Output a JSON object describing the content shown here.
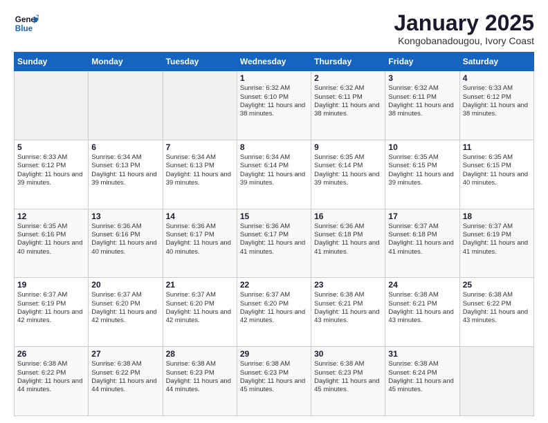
{
  "logo": {
    "line1": "General",
    "line2": "Blue"
  },
  "title": "January 2025",
  "subtitle": "Kongobanadougou, Ivory Coast",
  "days_header": [
    "Sunday",
    "Monday",
    "Tuesday",
    "Wednesday",
    "Thursday",
    "Friday",
    "Saturday"
  ],
  "weeks": [
    [
      {
        "day": "",
        "info": ""
      },
      {
        "day": "",
        "info": ""
      },
      {
        "day": "",
        "info": ""
      },
      {
        "day": "1",
        "info": "Sunrise: 6:32 AM\nSunset: 6:10 PM\nDaylight: 11 hours and 38 minutes."
      },
      {
        "day": "2",
        "info": "Sunrise: 6:32 AM\nSunset: 6:11 PM\nDaylight: 11 hours and 38 minutes."
      },
      {
        "day": "3",
        "info": "Sunrise: 6:32 AM\nSunset: 6:11 PM\nDaylight: 11 hours and 38 minutes."
      },
      {
        "day": "4",
        "info": "Sunrise: 6:33 AM\nSunset: 6:12 PM\nDaylight: 11 hours and 38 minutes."
      }
    ],
    [
      {
        "day": "5",
        "info": "Sunrise: 6:33 AM\nSunset: 6:12 PM\nDaylight: 11 hours and 39 minutes."
      },
      {
        "day": "6",
        "info": "Sunrise: 6:34 AM\nSunset: 6:13 PM\nDaylight: 11 hours and 39 minutes."
      },
      {
        "day": "7",
        "info": "Sunrise: 6:34 AM\nSunset: 6:13 PM\nDaylight: 11 hours and 39 minutes."
      },
      {
        "day": "8",
        "info": "Sunrise: 6:34 AM\nSunset: 6:14 PM\nDaylight: 11 hours and 39 minutes."
      },
      {
        "day": "9",
        "info": "Sunrise: 6:35 AM\nSunset: 6:14 PM\nDaylight: 11 hours and 39 minutes."
      },
      {
        "day": "10",
        "info": "Sunrise: 6:35 AM\nSunset: 6:15 PM\nDaylight: 11 hours and 39 minutes."
      },
      {
        "day": "11",
        "info": "Sunrise: 6:35 AM\nSunset: 6:15 PM\nDaylight: 11 hours and 40 minutes."
      }
    ],
    [
      {
        "day": "12",
        "info": "Sunrise: 6:35 AM\nSunset: 6:16 PM\nDaylight: 11 hours and 40 minutes."
      },
      {
        "day": "13",
        "info": "Sunrise: 6:36 AM\nSunset: 6:16 PM\nDaylight: 11 hours and 40 minutes."
      },
      {
        "day": "14",
        "info": "Sunrise: 6:36 AM\nSunset: 6:17 PM\nDaylight: 11 hours and 40 minutes."
      },
      {
        "day": "15",
        "info": "Sunrise: 6:36 AM\nSunset: 6:17 PM\nDaylight: 11 hours and 41 minutes."
      },
      {
        "day": "16",
        "info": "Sunrise: 6:36 AM\nSunset: 6:18 PM\nDaylight: 11 hours and 41 minutes."
      },
      {
        "day": "17",
        "info": "Sunrise: 6:37 AM\nSunset: 6:18 PM\nDaylight: 11 hours and 41 minutes."
      },
      {
        "day": "18",
        "info": "Sunrise: 6:37 AM\nSunset: 6:19 PM\nDaylight: 11 hours and 41 minutes."
      }
    ],
    [
      {
        "day": "19",
        "info": "Sunrise: 6:37 AM\nSunset: 6:19 PM\nDaylight: 11 hours and 42 minutes."
      },
      {
        "day": "20",
        "info": "Sunrise: 6:37 AM\nSunset: 6:20 PM\nDaylight: 11 hours and 42 minutes."
      },
      {
        "day": "21",
        "info": "Sunrise: 6:37 AM\nSunset: 6:20 PM\nDaylight: 11 hours and 42 minutes."
      },
      {
        "day": "22",
        "info": "Sunrise: 6:37 AM\nSunset: 6:20 PM\nDaylight: 11 hours and 42 minutes."
      },
      {
        "day": "23",
        "info": "Sunrise: 6:38 AM\nSunset: 6:21 PM\nDaylight: 11 hours and 43 minutes."
      },
      {
        "day": "24",
        "info": "Sunrise: 6:38 AM\nSunset: 6:21 PM\nDaylight: 11 hours and 43 minutes."
      },
      {
        "day": "25",
        "info": "Sunrise: 6:38 AM\nSunset: 6:22 PM\nDaylight: 11 hours and 43 minutes."
      }
    ],
    [
      {
        "day": "26",
        "info": "Sunrise: 6:38 AM\nSunset: 6:22 PM\nDaylight: 11 hours and 44 minutes."
      },
      {
        "day": "27",
        "info": "Sunrise: 6:38 AM\nSunset: 6:22 PM\nDaylight: 11 hours and 44 minutes."
      },
      {
        "day": "28",
        "info": "Sunrise: 6:38 AM\nSunset: 6:23 PM\nDaylight: 11 hours and 44 minutes."
      },
      {
        "day": "29",
        "info": "Sunrise: 6:38 AM\nSunset: 6:23 PM\nDaylight: 11 hours and 45 minutes."
      },
      {
        "day": "30",
        "info": "Sunrise: 6:38 AM\nSunset: 6:23 PM\nDaylight: 11 hours and 45 minutes."
      },
      {
        "day": "31",
        "info": "Sunrise: 6:38 AM\nSunset: 6:24 PM\nDaylight: 11 hours and 45 minutes."
      },
      {
        "day": "",
        "info": ""
      }
    ]
  ]
}
